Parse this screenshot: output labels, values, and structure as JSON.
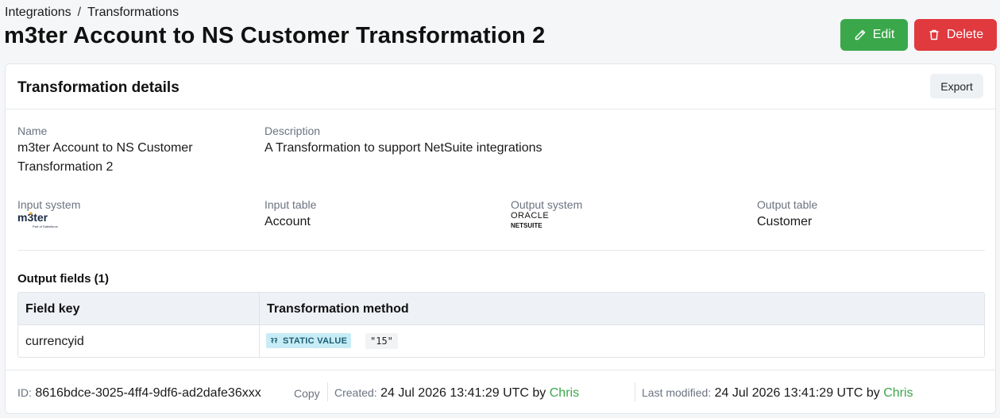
{
  "breadcrumb": {
    "items": [
      "Integrations",
      "Transformations"
    ],
    "separator": "/"
  },
  "page_title": "m3ter Account to NS Customer Transformation 2",
  "actions": {
    "edit_label": "Edit",
    "delete_label": "Delete"
  },
  "colors": {
    "edit": "#3aa84a",
    "delete": "#e0393e",
    "user_link": "#3aa84a"
  },
  "card": {
    "title": "Transformation details",
    "export_label": "Export",
    "fields": {
      "name_label": "Name",
      "name_line1": "m3ter Account to NS Customer",
      "name_line2": "Transformation 2",
      "description_label": "Description",
      "description_value": "A Transformation to support NetSuite integrations",
      "input_system_label": "Input system",
      "input_system_logo": {
        "wordmark": "m3ter",
        "tagline": "Part of Salesforce"
      },
      "input_table_label": "Input table",
      "input_table_value": "Account",
      "output_system_label": "Output system",
      "output_system_logo": {
        "wordmark": "ORACLE",
        "sub": "NETSUITE"
      },
      "output_table_label": "Output table",
      "output_table_value": "Customer"
    },
    "output_fields": {
      "title": "Output fields (1)",
      "columns": [
        "Field key",
        "Transformation method"
      ],
      "rows": [
        {
          "field_key": "currencyid",
          "method_badge": "STATIC VALUE",
          "method_value": "\"15\""
        }
      ]
    },
    "footer": {
      "id_label": "ID:",
      "id_value": "8616bdce-3025-4ff4-9df6-ad2dafe36xxx",
      "copy_label": "Copy",
      "created_label": "Created:",
      "created_value": "24 Jul 2026 13:41:29 UTC by",
      "created_by": "Chris",
      "modified_label": "Last modified:",
      "modified_value": "24 Jul 2026 13:41:29 UTC by",
      "modified_by": "Chris"
    }
  }
}
